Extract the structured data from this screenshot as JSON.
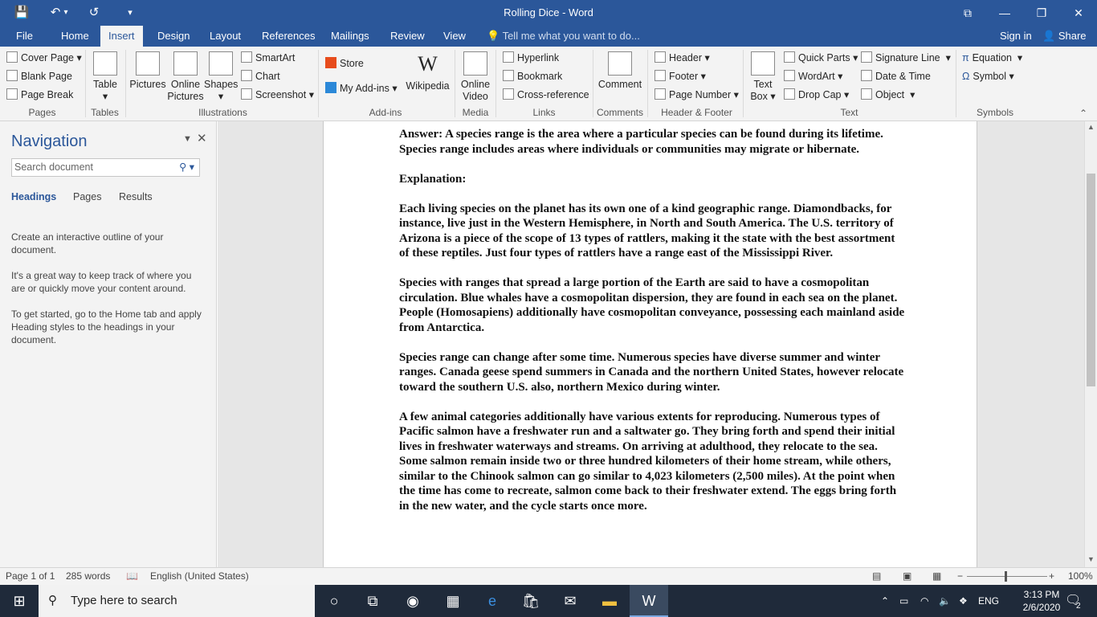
{
  "app": {
    "title": "Rolling Dice - Word"
  },
  "titlebar": {
    "icons": {
      "save": "💾",
      "undo": "↶",
      "redo": "↺",
      "customize": "▾"
    },
    "window_buttons": {
      "ribbon_display": "⧉",
      "minimize": "—",
      "restore": "❐",
      "close": "✕"
    }
  },
  "tabs": [
    "File",
    "Home",
    "Insert",
    "Design",
    "Layout",
    "References",
    "Mailings",
    "Review",
    "View"
  ],
  "tell_me": {
    "placeholder": "Tell me what you want to do..."
  },
  "account": {
    "sign_in": "Sign in",
    "share": "Share"
  },
  "ribbon": {
    "pages": {
      "label": "Pages",
      "cover_page": "Cover Page",
      "blank_page": "Blank Page",
      "page_break": "Page Break"
    },
    "tables": {
      "label": "Tables",
      "table": "Table"
    },
    "illustrations": {
      "label": "Illustrations",
      "pictures": "Pictures",
      "online": "Online",
      "pictures2": "Pictures",
      "shapes": "Shapes",
      "smartart": "SmartArt",
      "chart": "Chart",
      "screenshot": "Screenshot"
    },
    "addins": {
      "label": "Add-ins",
      "store": "Store",
      "my_addins": "My Add-ins",
      "wikipedia": "Wikipedia",
      "wiki_logo": "W"
    },
    "media": {
      "label": "Media",
      "online": "Online",
      "video": "Video"
    },
    "links": {
      "label": "Links",
      "hyperlink": "Hyperlink",
      "bookmark": "Bookmark",
      "cross_reference": "Cross-reference"
    },
    "comments": {
      "label": "Comments",
      "comment": "Comment"
    },
    "header_footer": {
      "label": "Header & Footer",
      "header": "Header",
      "footer": "Footer",
      "page_number": "Page Number"
    },
    "text": {
      "label": "Text",
      "text": "Text",
      "box": "Box",
      "quick_parts": "Quick Parts",
      "wordart": "WordArt",
      "drop_cap": "Drop Cap",
      "signature_line": "Signature Line",
      "date_time": "Date & Time",
      "object": "Object"
    },
    "symbols": {
      "label": "Symbols",
      "equation": "Equation",
      "symbol": "Symbol"
    }
  },
  "navigation": {
    "title": "Navigation",
    "search_placeholder": "Search document",
    "tabs": [
      "Headings",
      "Pages",
      "Results"
    ],
    "help": [
      "Create an interactive outline of your document.",
      "It's a great way to keep track of where you are or quickly move your content around.",
      "To get started, go to the Home tab and apply Heading styles to the headings in your document."
    ]
  },
  "document": {
    "paragraphs": [
      "Answer: A species range is the area where a particular species can be found during its lifetime. Species range includes areas where individuals or communities may migrate or hibernate.",
      "Explanation:",
      "Each living species on the planet has its own one of a kind geographic range. Diamondbacks, for instance, live just in the Western Hemisphere, in North and South America. The U.S. territory of Arizona is a piece of the scope of 13 types of rattlers, making it the state with the best assortment of these reptiles. Just four types of rattlers have a range east of the Mississippi River.",
      "Species with ranges that spread a large portion of the Earth are said to have a cosmopolitan circulation. Blue whales have a cosmopolitan dispersion, they are found in each sea on the planet. People (Homosapiens) additionally have cosmopolitan conveyance, possessing each mainland aside from Antarctica.",
      "Species range can change after some time. Numerous species have diverse summer and winter ranges. Canada geese spend summers in Canada and the northern United States, however relocate toward the southern U.S. also, northern Mexico during winter.",
      "A few animal categories additionally have various extents for reproducing. Numerous types of Pacific salmon have a freshwater run and a saltwater go. They bring forth and spend their initial lives in freshwater waterways and streams. On arriving at adulthood, they relocate to the sea. Some salmon remain inside two or three hundred kilometers of their home stream, while others, similar to the Chinook salmon can go similar to 4,023 kilometers (2,500 miles). At the point when the time has come to recreate, salmon come back to their freshwater extend. The eggs bring forth in the new water, and the cycle starts once more."
    ]
  },
  "status": {
    "page": "Page 1 of 1",
    "words": "285 words",
    "language": "English (United States)",
    "zoom": "100%"
  },
  "taskbar": {
    "search_placeholder": "Type here to search",
    "language": "ENG",
    "time": "3:13 PM",
    "date": "2/6/2020",
    "notifications": "2"
  },
  "colors": {
    "word_blue": "#2b579a",
    "ribbon_bg": "#f3f3f3",
    "taskbar_bg": "#1f2a3a"
  }
}
